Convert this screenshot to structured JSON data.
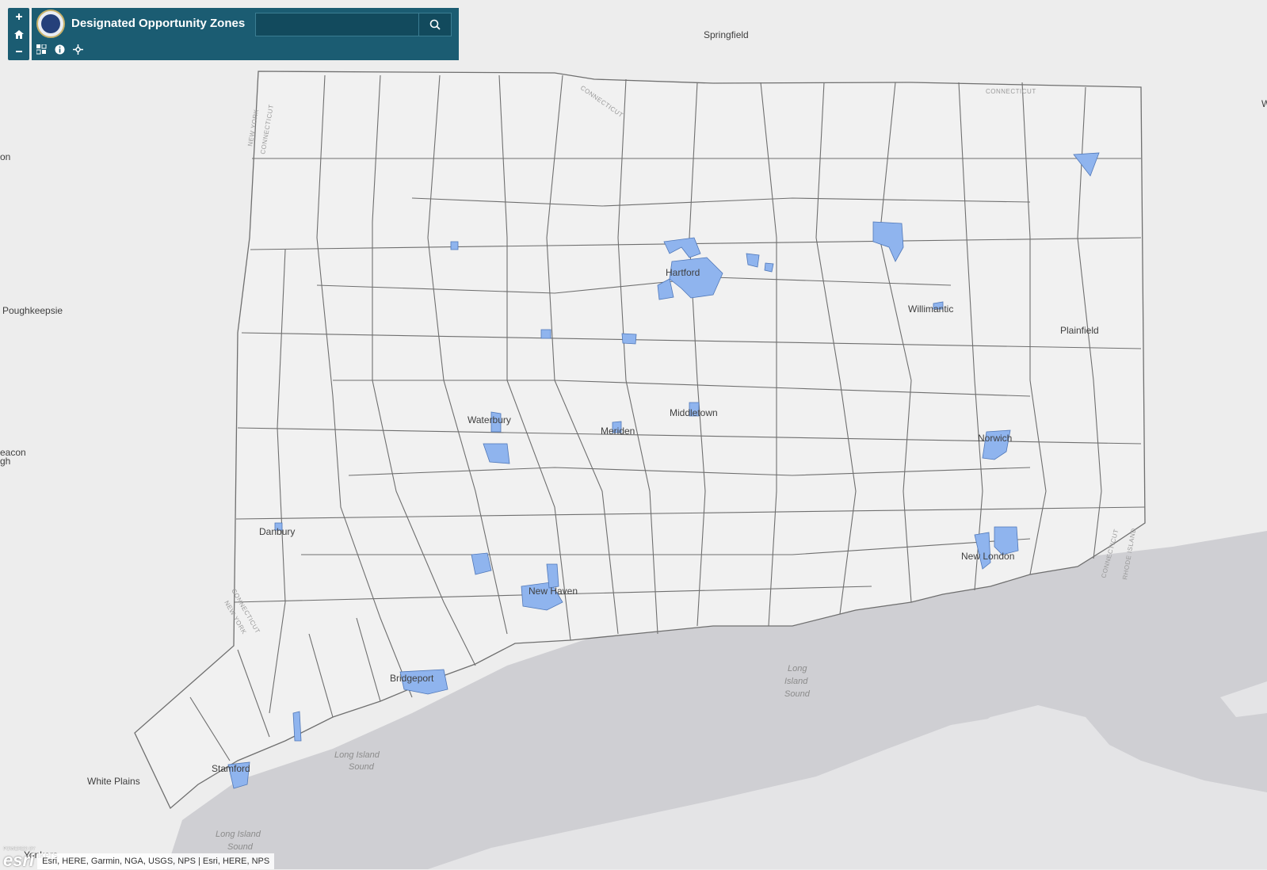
{
  "app": {
    "title": "Designated Opportunity Zones",
    "search_placeholder": ""
  },
  "icons": {
    "zoom_in": "plus-icon",
    "home": "home-icon",
    "zoom_out": "minus-icon",
    "search": "search-icon",
    "legend": "legend-icon",
    "info": "info-icon",
    "locate": "locate-icon"
  },
  "colors": {
    "header": "#1b5c72",
    "zone_fill": "#8fb4ee",
    "zone_stroke": "#4f77b8",
    "town_border": "#6f6f6f",
    "water": "#cfcfd3"
  },
  "map_labels": {
    "cities": [
      "Springfield",
      "Hartford",
      "Willimantic",
      "Plainfield",
      "Waterbury",
      "Meriden",
      "Middletown",
      "Norwich",
      "Danbury",
      "New Haven",
      "New London",
      "Bridgeport",
      "Stamford",
      "White Plains",
      "Poughkeepsie",
      "Yonkers",
      "on",
      "eacon",
      "gh",
      "W"
    ],
    "water": [
      "Long",
      "Island",
      "Sound",
      "Long Island",
      "Sound",
      "Long Island",
      "Sound"
    ],
    "borders": [
      "CONNECTICUT",
      "CONNECTICUT",
      "NEW YORK",
      "CONNECTICUT",
      "CONNECTICUT",
      "NEW YORK",
      "CONNECTICUT",
      "RHODE ISLAND"
    ]
  },
  "attribution": {
    "logo_text": "esri",
    "powered_by": "POWERED BY",
    "text": "Esri, HERE, Garmin, NGA, USGS, NPS | Esri, HERE, NPS"
  }
}
